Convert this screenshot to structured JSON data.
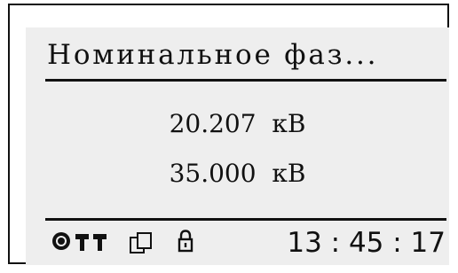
{
  "screen": {
    "title": "Номинальное фаз...",
    "values": [
      "20.207  кВ",
      "35.000  кВ"
    ]
  },
  "status_bar": {
    "icons": [
      "record-icon",
      "signal-icon",
      "document-icon",
      "lock-icon"
    ],
    "time": "13 : 45 : 17"
  },
  "colors": {
    "text": "#111111",
    "screen_background": "#eeeeee",
    "frame": "#111111"
  }
}
